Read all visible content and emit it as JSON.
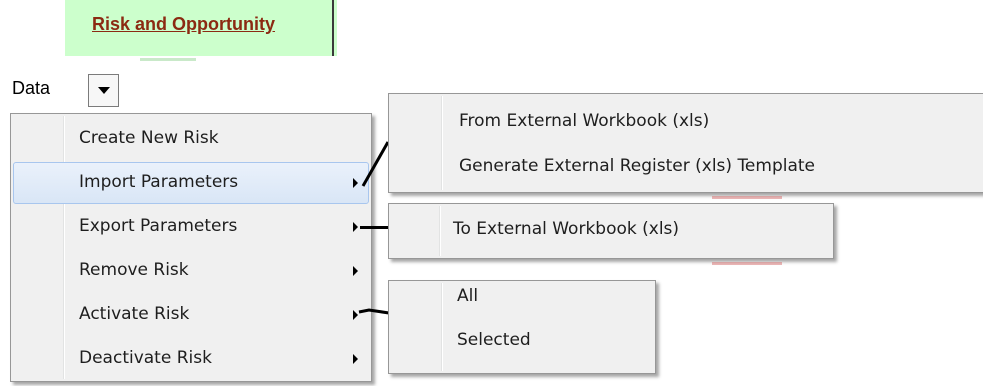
{
  "title": {
    "text": "Risk and Opportunity"
  },
  "data_button": {
    "label": "Data"
  },
  "main_menu": {
    "items": [
      {
        "label": "Create New Risk",
        "has_submenu": false
      },
      {
        "label": "Import Parameters",
        "has_submenu": true,
        "highlighted": true
      },
      {
        "label": "Export Parameters",
        "has_submenu": true
      },
      {
        "label": "Remove Risk",
        "has_submenu": true
      },
      {
        "label": "Activate Risk",
        "has_submenu": true
      },
      {
        "label": "Deactivate Risk",
        "has_submenu": true
      }
    ]
  },
  "import_submenu": {
    "items": [
      {
        "label": "From External Workbook (xls)"
      },
      {
        "label": "Generate External Register (xls) Template"
      }
    ]
  },
  "export_submenu": {
    "items": [
      {
        "label": "To External Workbook (xls)"
      }
    ]
  },
  "activate_submenu": {
    "items": [
      {
        "label": "All"
      },
      {
        "label": "Selected"
      }
    ]
  },
  "colors": {
    "title_cell_bg": "#ccffcc",
    "title_text": "#8b2a12",
    "menu_bg": "#f0f0f0",
    "highlight_border": "#a8c6ee"
  }
}
